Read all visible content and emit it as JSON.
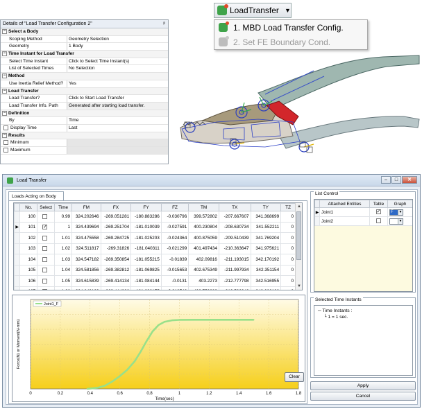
{
  "details": {
    "title": "Details of \"Load Transfer Configuration 2\"",
    "pin": "ᵖ",
    "groups": [
      {
        "name": "Select a Body",
        "rows": [
          {
            "k": "Scoping Method",
            "v": "Geometry Selection"
          },
          {
            "k": "Geometry",
            "v": "1 Body"
          }
        ]
      },
      {
        "name": "Time Instant for Load Transfer",
        "rows": [
          {
            "k": "Select Time Instant",
            "v": "Click to Select Time Instant(s)"
          },
          {
            "k": "List of Selected Times",
            "v": "No Selection"
          }
        ]
      },
      {
        "name": "Method",
        "rows": [
          {
            "k": "Use Inertia Relief Method?",
            "v": "Yes"
          }
        ]
      },
      {
        "name": "Load Transfer",
        "rows": [
          {
            "k": "Load Transfer?",
            "v": "Click to Start Load Transfer"
          },
          {
            "k": "Load Transfer Info. Path",
            "v": "Generated after starting load transfer."
          }
        ]
      },
      {
        "name": "Definition",
        "rows": [
          {
            "k": "By",
            "v": "Time"
          },
          {
            "k": "Display Time",
            "v": "Last"
          }
        ]
      },
      {
        "name": "Results",
        "rows": [
          {
            "k": "Minimum",
            "v": ""
          },
          {
            "k": "Maximum",
            "v": ""
          }
        ]
      }
    ]
  },
  "menu": {
    "button_label": "LoadTransfer",
    "items": [
      {
        "label": "1. MBD Load Transfer Config.",
        "enabled": true
      },
      {
        "label": "2. Set FE Boundary Cond.",
        "enabled": false
      }
    ]
  },
  "dialog": {
    "title": "Load Transfer",
    "tab": "Loads Acting on Body",
    "columns": [
      "No.",
      "Select",
      "Time",
      "FM",
      "FX",
      "FY",
      "FZ",
      "TM",
      "TX",
      "TY",
      "TZ"
    ],
    "rows": [
      {
        "no": "100",
        "sel": false,
        "time": "0.99",
        "fm": "324.202646",
        "fx": "-269.051281",
        "fy": "-180.883286",
        "fz": "-0.030796",
        "tm": "399.572802",
        "tx": "-207.667607",
        "ty": "341.368699",
        "tz": "0"
      },
      {
        "no": "101",
        "sel": true,
        "time": "1",
        "fm": "324.439694",
        "fx": "-269.251704",
        "fy": "-181.010039",
        "fz": "-0.027591",
        "tm": "400.230804",
        "tx": "-208.630734",
        "ty": "341.552211",
        "tz": "0"
      },
      {
        "no": "102",
        "sel": false,
        "time": "1.01",
        "fm": "324.475558",
        "fx": "-269.284725",
        "fy": "-181.025203",
        "fz": "-0.024364",
        "tm": "400.875059",
        "tx": "-209.510439",
        "ty": "341.769204",
        "tz": "0"
      },
      {
        "no": "103",
        "sel": false,
        "time": "1.02",
        "fm": "324.511817",
        "fx": "-269.31826",
        "fy": "-181.040311",
        "fz": "-0.021299",
        "tm": "401.497434",
        "tx": "-210.363647",
        "ty": "341.975621",
        "tz": "0"
      },
      {
        "no": "104",
        "sel": false,
        "time": "1.03",
        "fm": "324.547182",
        "fx": "-269.350854",
        "fy": "-181.055215",
        "fz": "-0.01839",
        "tm": "402.09816",
        "tx": "-211.193015",
        "ty": "342.170192",
        "tz": "0"
      },
      {
        "no": "105",
        "sel": false,
        "time": "1.04",
        "fm": "324.581856",
        "fx": "-269.382812",
        "fy": "-181.069825",
        "fz": "-0.015653",
        "tm": "402.675349",
        "tx": "-211.997934",
        "ty": "342.351154",
        "tz": "0"
      },
      {
        "no": "106",
        "sel": false,
        "time": "1.05",
        "fm": "324.615839",
        "fx": "-269.414134",
        "fy": "-181.084144",
        "fz": "-0.0131",
        "tm": "403.2273",
        "tx": "-212.777798",
        "ty": "342.516955",
        "tz": "0"
      },
      {
        "no": "107",
        "sel": false,
        "time": "1.06",
        "fm": "324.649139",
        "fx": "-269.444826",
        "fy": "-181.098175",
        "fz": "-0.010743",
        "tm": "403.752389",
        "tx": "-213.532043",
        "ty": "342.666103",
        "tz": "0"
      },
      {
        "no": "108",
        "sel": false,
        "time": "1.07",
        "fm": "324.68126",
        "fx": "-269.474892",
        "fy": "-181.111921",
        "fz": "-0.008593",
        "tm": "404.249072",
        "tx": "-214.260151",
        "ty": "342.79717",
        "tz": "0"
      }
    ],
    "list_control": {
      "label": "List Control",
      "columns": [
        "Attached Entities",
        "Table",
        "Graph"
      ],
      "rows": [
        {
          "name": "Joint1",
          "table": true,
          "graph": "F"
        },
        {
          "name": "Joint2",
          "table": false,
          "graph": ""
        }
      ]
    },
    "selected_time": {
      "label": "Selected Time Instants",
      "header": "Time Instants :",
      "items": [
        "1 = 1 sec."
      ]
    },
    "buttons": {
      "apply": "Apply",
      "cancel": "Cancel",
      "clear": "Clear"
    }
  },
  "chart_data": {
    "type": "line",
    "title": "",
    "xlabel": "Time(sec)",
    "ylabel": "Force(N) or Moment(N-mm)",
    "xlim": [
      0,
      1.8
    ],
    "x_ticks": [
      "0",
      "0.2",
      "0.4",
      "0.6",
      "0.8",
      "1",
      "1.2",
      "1.4",
      "1.6",
      "1.8"
    ],
    "legend": "top-left",
    "series": [
      {
        "name": "Joint1_F",
        "color": "#98e08a",
        "x": [
          0.38,
          0.45,
          0.5,
          0.55,
          0.6,
          0.65,
          0.7,
          0.74,
          0.78,
          0.82,
          0.86,
          0.9,
          0.95,
          1.0,
          1.1,
          1.2,
          1.3,
          1.4,
          1.5
        ],
        "y": [
          0,
          5,
          15,
          35,
          60,
          90,
          130,
          175,
          225,
          270,
          300,
          315,
          322,
          324,
          324.5,
          324.5,
          324.5,
          324.5,
          324.5
        ]
      }
    ],
    "ylim": [
      0,
      420
    ],
    "background": [
      "#fffbe6",
      "#f6cf1a"
    ]
  }
}
